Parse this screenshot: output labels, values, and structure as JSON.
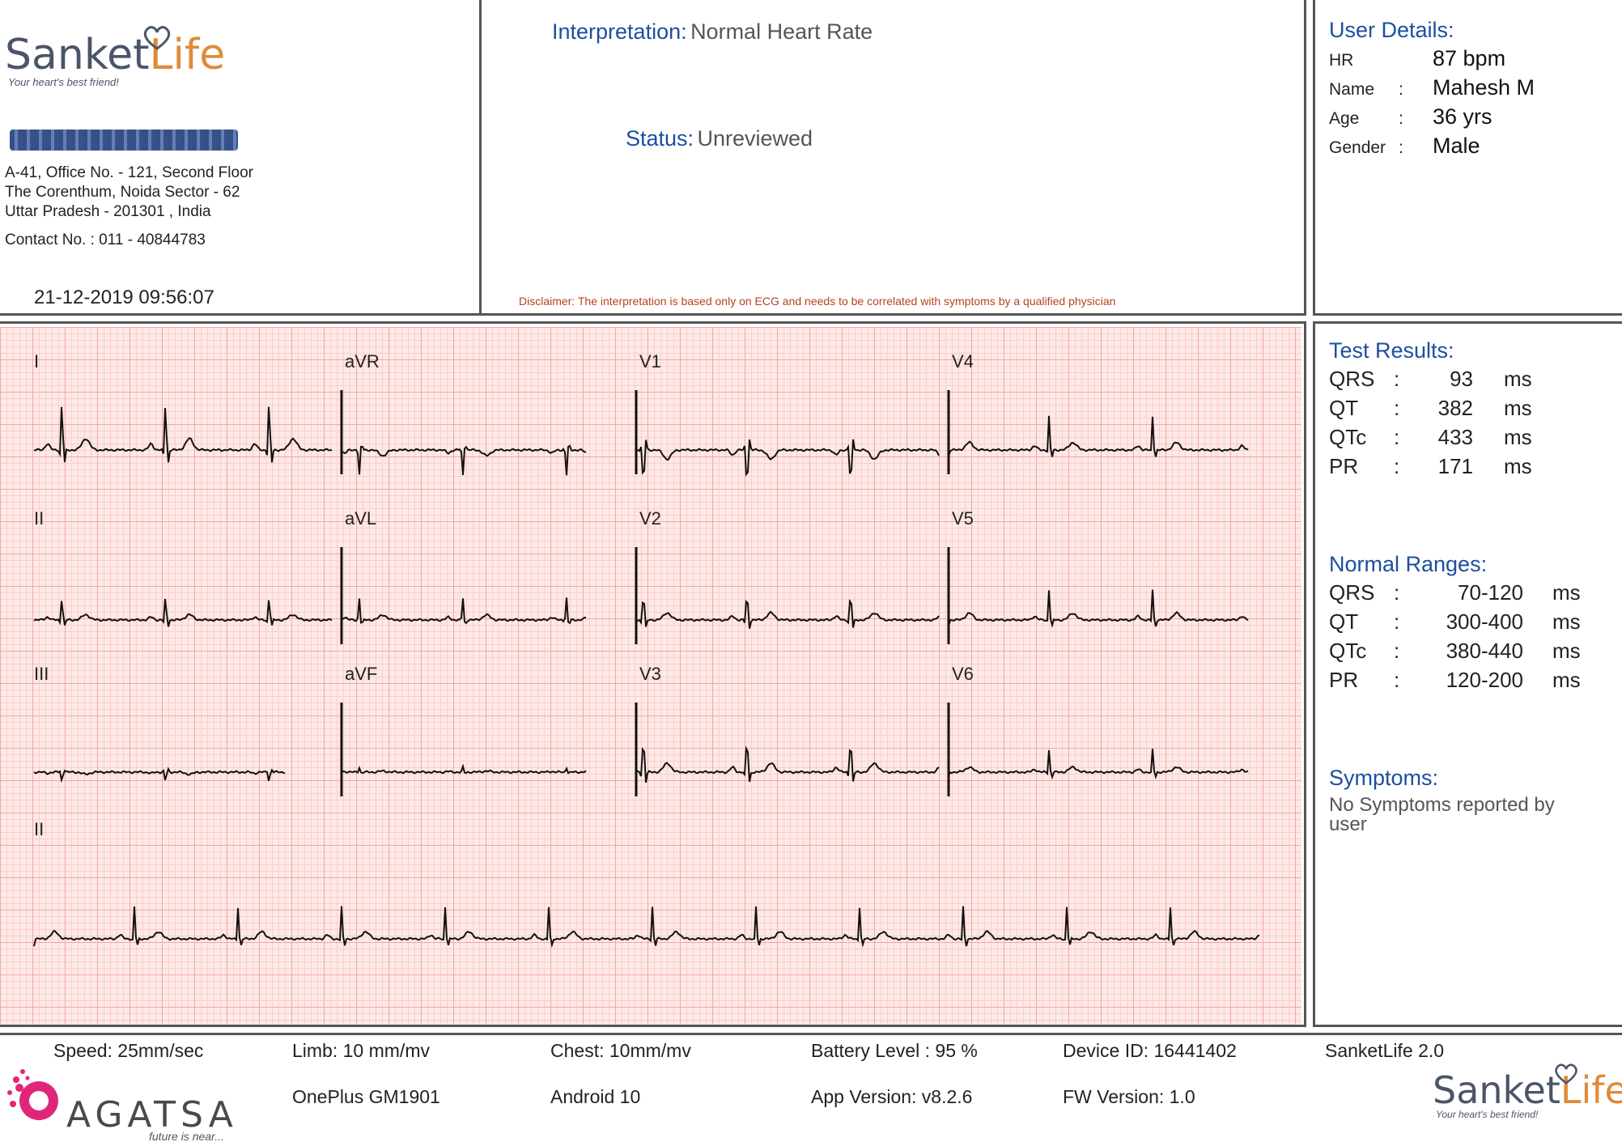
{
  "brand": {
    "logo_part1": "Sanket",
    "logo_part2": "Life",
    "tagline": "Your heart's best friend!"
  },
  "clinic": {
    "address_line1": "A-41, Office No. - 121, Second Floor",
    "address_line2": "The Corenthum, Noida Sector - 62",
    "address_line3": "Uttar Pradesh - 201301 , India",
    "contact": "Contact No. : 011 - 40844783"
  },
  "report": {
    "datetime": "21-12-2019 09:56:07",
    "interpretation_label": "Interpretation:",
    "interpretation_value": "Normal Heart Rate",
    "status_label": "Status:",
    "status_value": "Unreviewed",
    "disclaimer": "Disclaimer: The interpretation is based only on ECG and needs to be correlated with symptoms by a qualified physician"
  },
  "user_details": {
    "title": "User Details:",
    "rows": [
      {
        "key": "HR",
        "sep": "",
        "value": "87 bpm"
      },
      {
        "key": "Name",
        "sep": ":",
        "value": "Mahesh M"
      },
      {
        "key": "Age",
        "sep": ":",
        "value": "36 yrs"
      },
      {
        "key": "Gender",
        "sep": ":",
        "value": "Male"
      }
    ]
  },
  "test_results": {
    "title": "Test Results:",
    "rows": [
      {
        "key": "QRS",
        "sep": ":",
        "value": "93",
        "unit": "ms"
      },
      {
        "key": "QT",
        "sep": ":",
        "value": "382",
        "unit": "ms"
      },
      {
        "key": "QTc",
        "sep": ":",
        "value": "433",
        "unit": "ms"
      },
      {
        "key": "PR",
        "sep": ":",
        "value": "171",
        "unit": "ms"
      }
    ]
  },
  "normal_ranges": {
    "title": "Normal Ranges:",
    "rows": [
      {
        "key": "QRS",
        "sep": ":",
        "value": "70-120",
        "unit": "ms"
      },
      {
        "key": "QT",
        "sep": ":",
        "value": "300-400",
        "unit": "ms"
      },
      {
        "key": "QTc",
        "sep": ":",
        "value": "380-440",
        "unit": "ms"
      },
      {
        "key": "PR",
        "sep": ":",
        "value": "120-200",
        "unit": "ms"
      }
    ]
  },
  "symptoms": {
    "title": "Symptoms:",
    "text": "No Symptoms reported by user"
  },
  "leads": [
    "I",
    "aVR",
    "V1",
    "V4",
    "II",
    "aVL",
    "V2",
    "V5",
    "III",
    "aVF",
    "V3",
    "V6",
    "II"
  ],
  "footer": {
    "speed": "Speed: 25mm/sec",
    "limb": "Limb: 10 mm/mv",
    "chest": "Chest: 10mm/mv",
    "battery": "Battery Level : 95 %",
    "device_id": "Device ID: 16441402",
    "app_name": "SanketLife 2.0",
    "phone": "OnePlus GM1901",
    "android": "Android 10",
    "app_version": "App Version: v8.2.6",
    "fw_version": "FW Version: 1.0",
    "agatsa_logo": "AGATSA",
    "agatsa_tagline": "future is near..."
  }
}
